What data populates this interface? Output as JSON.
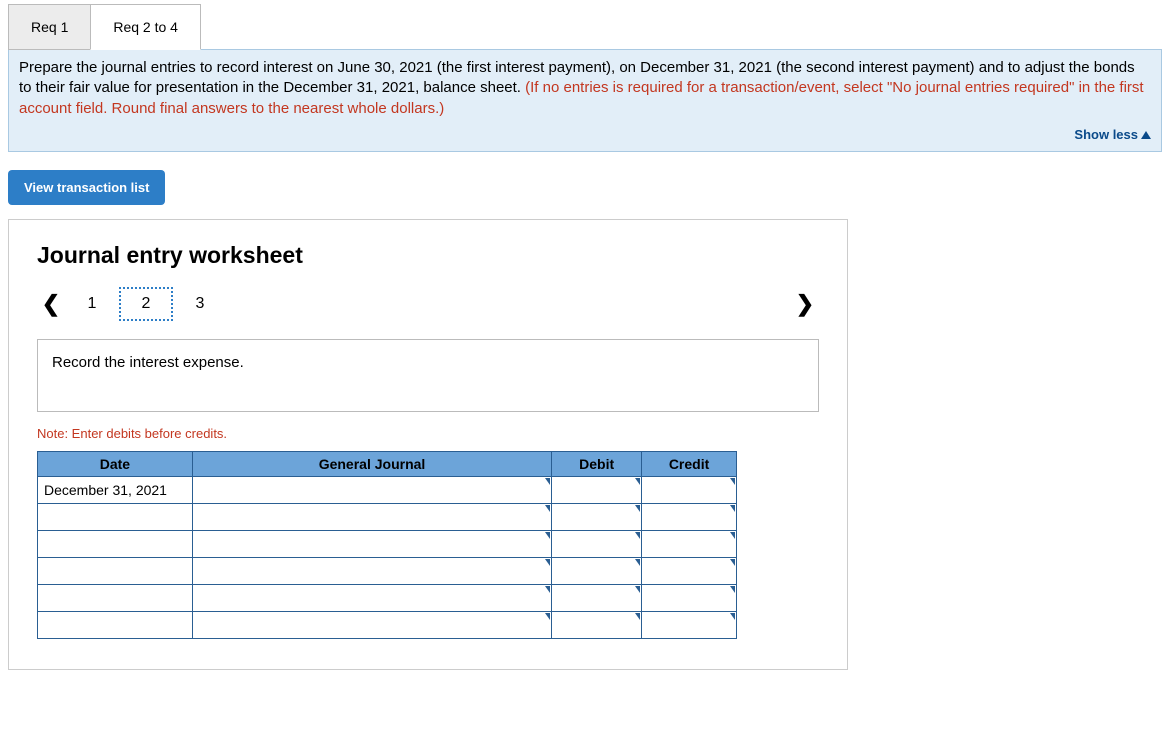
{
  "tabs": {
    "req1": "Req 1",
    "req2to4": "Req 2 to 4"
  },
  "instruction": {
    "black": "Prepare the journal entries to record interest on June 30, 2021 (the first interest payment), on December 31, 2021 (the second interest payment) and to adjust the bonds to their fair value for presentation in the December 31, 2021, balance sheet. ",
    "red": "(If no entries is required for a transaction/event, select \"No journal entries required\" in the first account field. Round final answers to the nearest whole dollars.)",
    "show_less": "Show less"
  },
  "buttons": {
    "view_transaction_list": "View transaction list"
  },
  "worksheet": {
    "title": "Journal entry worksheet",
    "pages": {
      "p1": "1",
      "p2": "2",
      "p3": "3"
    },
    "entry_instruction": "Record the interest expense.",
    "note": "Note: Enter debits before credits.",
    "headers": {
      "date": "Date",
      "gj": "General Journal",
      "debit": "Debit",
      "credit": "Credit"
    },
    "rows": [
      {
        "date": "December 31, 2021",
        "gj": "",
        "debit": "",
        "credit": ""
      },
      {
        "date": "",
        "gj": "",
        "debit": "",
        "credit": ""
      },
      {
        "date": "",
        "gj": "",
        "debit": "",
        "credit": ""
      },
      {
        "date": "",
        "gj": "",
        "debit": "",
        "credit": ""
      },
      {
        "date": "",
        "gj": "",
        "debit": "",
        "credit": ""
      },
      {
        "date": "",
        "gj": "",
        "debit": "",
        "credit": ""
      }
    ]
  }
}
